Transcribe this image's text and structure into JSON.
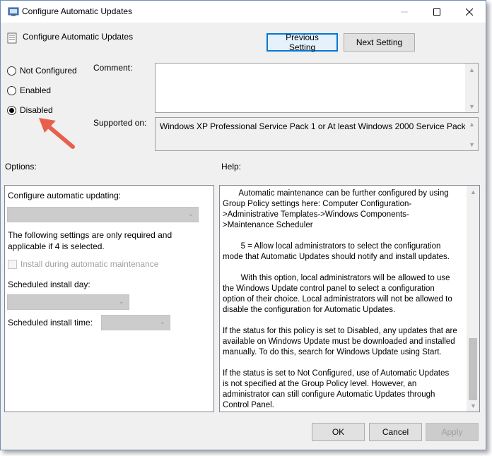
{
  "window": {
    "title": "Configure Automatic Updates",
    "minimize_icon": "minimize-icon",
    "maximize_icon": "maximize-icon",
    "close_icon": "close-icon"
  },
  "header": {
    "policy_title": "Configure Automatic Updates",
    "previous_setting": "Previous Setting",
    "next_setting": "Next Setting"
  },
  "state": {
    "options": [
      {
        "label": "Not Configured",
        "checked": false
      },
      {
        "label": "Enabled",
        "checked": false
      },
      {
        "label": "Disabled",
        "checked": true
      }
    ],
    "annotation": "red-arrow-pointing-at-disabled"
  },
  "comment": {
    "label": "Comment:",
    "value": ""
  },
  "supported": {
    "label": "Supported on:",
    "value": "Windows XP Professional Service Pack 1 or At least Windows 2000 Service Pack 3"
  },
  "options_pane": {
    "heading": "Options:",
    "configure_label": "Configure automatic updating:",
    "configure_value": "",
    "note": "The following settings are only required and applicable if 4 is selected.",
    "install_maintenance_label": "Install during automatic maintenance",
    "install_day_label": "Scheduled install day:",
    "install_day_value": "",
    "install_time_label": "Scheduled install time:",
    "install_time_value": ""
  },
  "help_pane": {
    "heading": "Help:",
    "text": "       Automatic maintenance can be further configured by using\nGroup Policy settings here: Computer Configuration-\n>Administrative Templates->Windows Components-\n>Maintenance Scheduler\n\n        5 = Allow local administrators to select the configuration\nmode that Automatic Updates should notify and install updates.\n\n        With this option, local administrators will be allowed to use\nthe Windows Update control panel to select a configuration\noption of their choice. Local administrators will not be allowed to\ndisable the configuration for Automatic Updates.\n\nIf the status for this policy is set to Disabled, any updates that are\navailable on Windows Update must be downloaded and installed\nmanually. To do this, search for Windows Update using Start.\n\nIf the status is set to Not Configured, use of Automatic Updates\nis not specified at the Group Policy level. However, an\nadministrator can still configure Automatic Updates through\nControl Panel."
  },
  "footer": {
    "ok": "OK",
    "cancel": "Cancel",
    "apply": "Apply"
  },
  "colors": {
    "accent": "#0078d7",
    "annotation_arrow": "#e8604c",
    "window_bg": "#f0f0f0"
  }
}
